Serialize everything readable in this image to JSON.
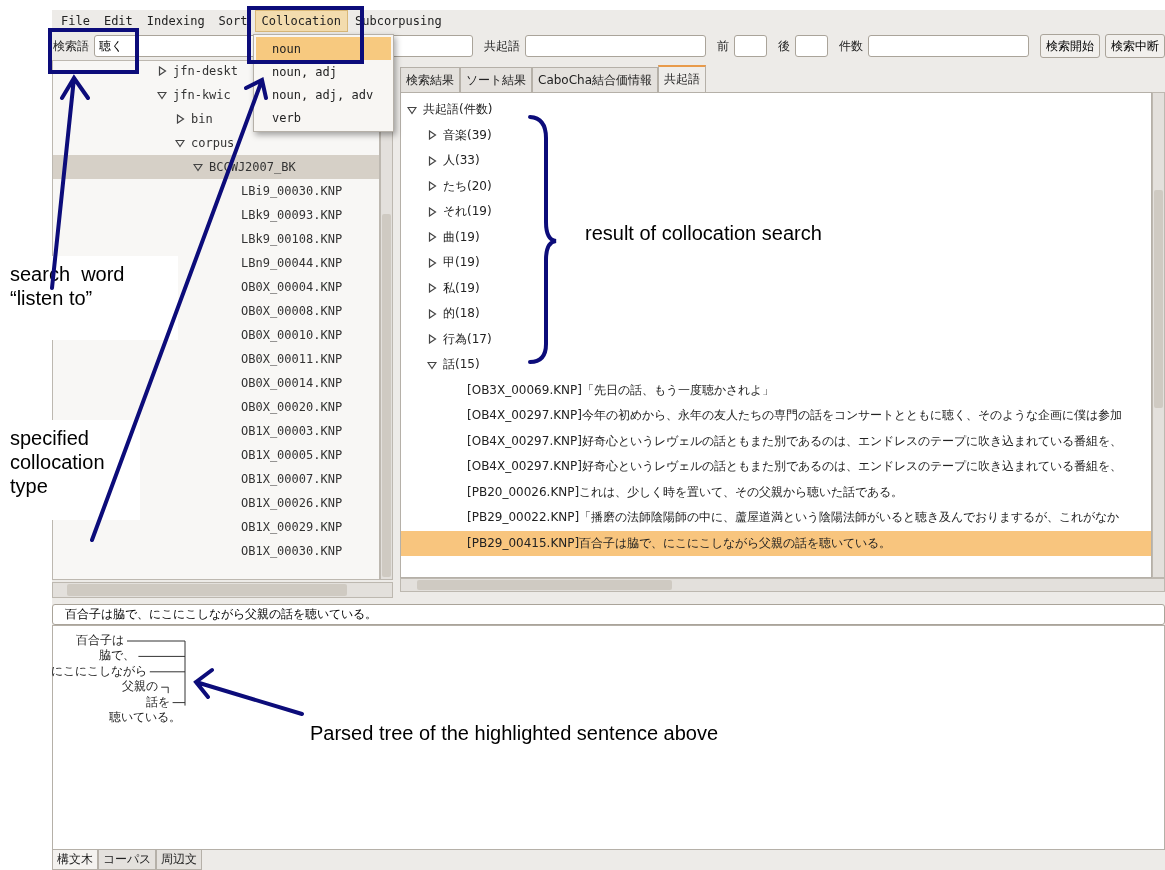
{
  "menu_bar": [
    {
      "label": "File",
      "selected": false
    },
    {
      "label": "Edit",
      "selected": false
    },
    {
      "label": "Indexing",
      "selected": false
    },
    {
      "label": "Sort",
      "selected": false
    },
    {
      "label": "Collocation",
      "selected": true
    },
    {
      "label": "Subcorpusing",
      "selected": false
    }
  ],
  "collocation_menu": [
    {
      "label": "noun",
      "selected": true
    },
    {
      "label": "noun, adj",
      "selected": false
    },
    {
      "label": "noun, adj, adv",
      "selected": false
    },
    {
      "label": "verb",
      "selected": false
    }
  ],
  "toolbar": {
    "fields": [
      {
        "label": "検索語",
        "value": "聴く"
      },
      {
        "label": "共起語"
      },
      {
        "label": "前"
      },
      {
        "label": "後"
      },
      {
        "label": "件数"
      }
    ],
    "buttons": [
      "検索開始",
      "検索中断"
    ]
  },
  "file_tree": [
    {
      "label": "jfn-deskt",
      "kind": "folder",
      "expanded": false,
      "selected": false
    },
    {
      "label": "jfn-kwic",
      "kind": "folder",
      "expanded": true,
      "selected": false,
      "children": [
        {
          "label": "bin",
          "kind": "folder",
          "expanded": false,
          "selected": false
        },
        {
          "label": "corpus",
          "kind": "folder",
          "expanded": true,
          "selected": false,
          "children": [
            {
              "label": "BCCWJ2007_BK",
              "kind": "folder",
              "expanded": true,
              "selected": true,
              "children": [
                {
                  "label": "LBi9_00030.KNP",
                  "kind": "file",
                  "selected": false
                },
                {
                  "label": "LBk9_00093.KNP",
                  "kind": "file",
                  "selected": false
                },
                {
                  "label": "LBk9_00108.KNP",
                  "kind": "file",
                  "selected": false
                },
                {
                  "label": "LBn9_00044.KNP",
                  "kind": "file",
                  "selected": false
                },
                {
                  "label": "OB0X_00004.KNP",
                  "kind": "file",
                  "selected": false
                },
                {
                  "label": "OB0X_00008.KNP",
                  "kind": "file",
                  "selected": false
                },
                {
                  "label": "OB0X_00010.KNP",
                  "kind": "file",
                  "selected": false
                },
                {
                  "label": "OB0X_00011.KNP",
                  "kind": "file",
                  "selected": false
                },
                {
                  "label": "OB0X_00014.KNP",
                  "kind": "file",
                  "selected": false
                },
                {
                  "label": "OB0X_00020.KNP",
                  "kind": "file",
                  "selected": false
                },
                {
                  "label": "OB1X_00003.KNP",
                  "kind": "file",
                  "selected": false
                },
                {
                  "label": "OB1X_00005.KNP",
                  "kind": "file",
                  "selected": false
                },
                {
                  "label": "OB1X_00007.KNP",
                  "kind": "file",
                  "selected": false
                },
                {
                  "label": "OB1X_00026.KNP",
                  "kind": "file",
                  "selected": false
                },
                {
                  "label": "OB1X_00029.KNP",
                  "kind": "file",
                  "selected": false
                },
                {
                  "label": "OB1X_00030.KNP",
                  "kind": "file",
                  "selected": false
                }
              ]
            }
          ]
        }
      ]
    }
  ],
  "result_tabs": [
    {
      "label": "検索結果",
      "selected": false
    },
    {
      "label": "ソート結果",
      "selected": false
    },
    {
      "label": "CaboCha結合価情報",
      "selected": false
    },
    {
      "label": "共起語",
      "selected": true
    }
  ],
  "collocation_results": [
    {
      "label": "共起語(件数)",
      "kind": "folder",
      "expanded": true,
      "selected": false,
      "children": [
        {
          "label": "音楽(39)",
          "kind": "folder",
          "expanded": false,
          "selected": false
        },
        {
          "label": "人(33)",
          "kind": "folder",
          "expanded": false,
          "selected": false
        },
        {
          "label": "たち(20)",
          "kind": "folder",
          "expanded": false,
          "selected": false
        },
        {
          "label": "それ(19)",
          "kind": "folder",
          "expanded": false,
          "selected": false
        },
        {
          "label": "曲(19)",
          "kind": "folder",
          "expanded": false,
          "selected": false
        },
        {
          "label": "甲(19)",
          "kind": "folder",
          "expanded": false,
          "selected": false
        },
        {
          "label": "私(19)",
          "kind": "folder",
          "expanded": false,
          "selected": false
        },
        {
          "label": "的(18)",
          "kind": "folder",
          "expanded": false,
          "selected": false
        },
        {
          "label": "行為(17)",
          "kind": "folder",
          "expanded": false,
          "selected": false
        },
        {
          "label": "話(15)",
          "kind": "folder",
          "expanded": true,
          "selected": false,
          "children": [
            {
              "label": "[OB3X_00069.KNP]「先日の話、もう一度聴かされよ」",
              "kind": "sentence",
              "selected": false
            },
            {
              "label": "[OB4X_00297.KNP]今年の初めから、永年の友人たちの専門の話をコンサートとともに聴く、そのような企画に僕は参加",
              "kind": "sentence",
              "selected": false
            },
            {
              "label": "[OB4X_00297.KNP]好奇心というレヴェルの話ともまた別であるのは、エンドレスのテープに吹き込まれている番組を、",
              "kind": "sentence",
              "selected": false
            },
            {
              "label": "[OB4X_00297.KNP]好奇心というレヴェルの話ともまた別であるのは、エンドレスのテープに吹き込まれている番組を、",
              "kind": "sentence",
              "selected": false
            },
            {
              "label": "[PB20_00026.KNP]これは、少しく時を置いて、その父親から聴いた話である。",
              "kind": "sentence",
              "selected": false
            },
            {
              "label": "[PB29_00022.KNP]「播磨の法師陰陽師の中に、蘆屋道満という陰陽法師がいると聴き及んでおりまするが、これがなか",
              "kind": "sentence",
              "selected": false
            },
            {
              "label": "[PB29_00415.KNP]百合子は脇で、にこにこしながら父親の話を聴いている。",
              "kind": "sentence",
              "selected": true
            }
          ]
        }
      ]
    }
  ],
  "sentence": "百合子は脇で、にこにこしながら父親の話を聴いている。",
  "parse_tree": [
    {
      "text": "百合子は",
      "kind": "to_head"
    },
    {
      "text": "脇で、",
      "kind": "to_head"
    },
    {
      "text": "にこにこしながら",
      "kind": "to_head"
    },
    {
      "text": "父親の",
      "kind": "to_next"
    },
    {
      "text": "話を",
      "kind": "to_head"
    },
    {
      "text": "聴いている。",
      "kind": "head"
    }
  ],
  "bottom_tabs": [
    {
      "label": "構文木",
      "selected": true
    },
    {
      "label": "コーパス",
      "selected": false
    },
    {
      "label": "周辺文",
      "selected": false
    }
  ],
  "annotations": [
    {
      "text": "search  word “listen to”"
    },
    {
      "text": "specified collocation type"
    },
    {
      "text": "result of collocation search"
    },
    {
      "text": "Parsed tree of the highlighted sentence above"
    }
  ]
}
